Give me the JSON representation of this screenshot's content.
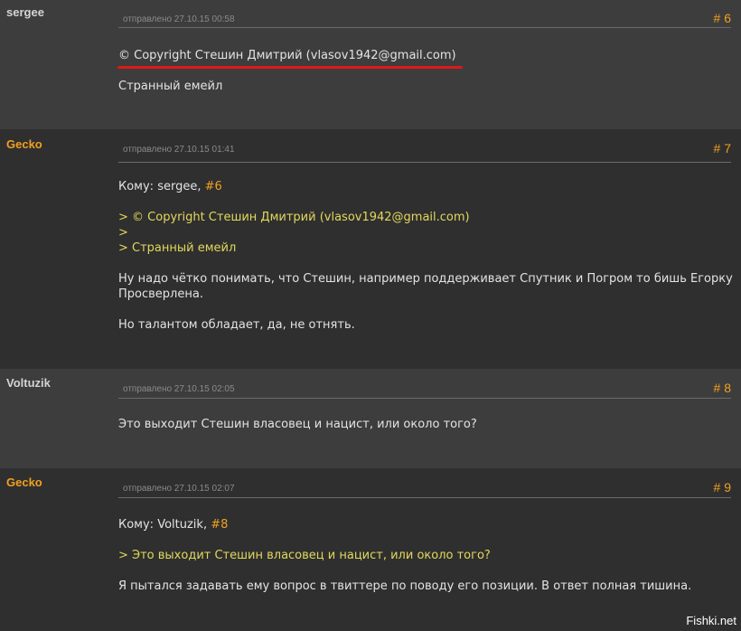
{
  "posts": [
    {
      "author": "sergee",
      "date": "отправлено 27.10.15 00:58",
      "number": "# 6",
      "lines": [
        "© Copyright Стешин Дмитрий (vlasov1942@gmail.com)",
        "Странный емейл"
      ]
    },
    {
      "author": "Gecko",
      "date": "отправлено 27.10.15 01:41",
      "number": "# 7",
      "to_prefix": "Кому: sergee, ",
      "to_ref": "#6",
      "quote": [
        "> © Copyright Стешин Дмитрий (vlasov1942@gmail.com)",
        ">",
        "> Странный емейл"
      ],
      "lines": [
        "Ну надо чётко понимать, что Стешин, например поддерживает Спутник и Погром то бишь Егорку Просверлена.",
        "Но талантом обладает, да, не отнять."
      ]
    },
    {
      "author": "Voltuzik",
      "date": "отправлено 27.10.15 02:05",
      "number": "# 8",
      "lines": [
        "Это выходит Стешин власовец и нацист, или около того?"
      ]
    },
    {
      "author": "Gecko",
      "date": "отправлено 27.10.15 02:07",
      "number": "# 9",
      "to_prefix": "Кому: Voltuzik, ",
      "to_ref": "#8",
      "quote": [
        "> Это выходит Стешин власовец и нацист, или около того?"
      ],
      "lines": [
        "Я пытался задавать ему вопрос в твиттере по поводу его позиции. В ответ полная тишина."
      ]
    }
  ],
  "watermark": "Fishki.net",
  "colors": {
    "accent": "#f0a020",
    "quote": "#e2d85c",
    "highlight": "#e01818"
  }
}
